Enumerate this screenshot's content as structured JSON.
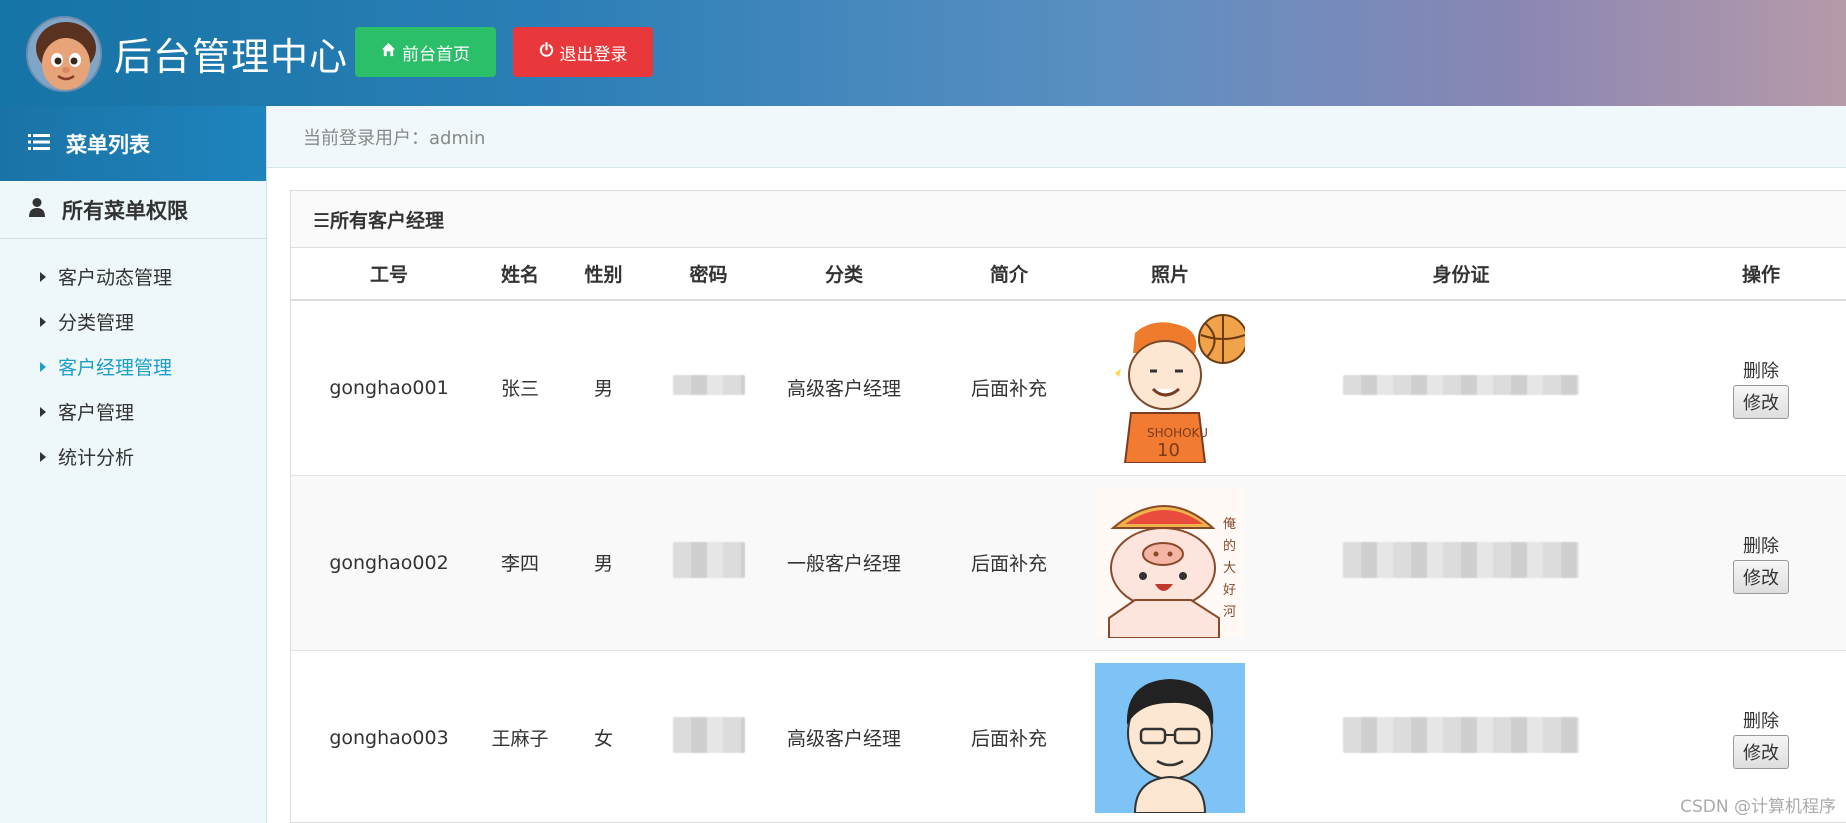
{
  "header": {
    "title": "后台管理中心",
    "home_button": "前台首页",
    "logout_button": "退出登录"
  },
  "sidebar": {
    "heading": "菜单列表",
    "section": "所有菜单权限",
    "items": [
      {
        "label": "客户动态管理"
      },
      {
        "label": "分类管理"
      },
      {
        "label": "客户经理管理"
      },
      {
        "label": "客户管理"
      },
      {
        "label": "统计分析"
      }
    ]
  },
  "userbar": {
    "text": "当前登录用户：admin"
  },
  "panel": {
    "title": "☰所有客户经理",
    "columns": [
      "工号",
      "姓名",
      "性别",
      "密码",
      "分类",
      "简介",
      "照片",
      "身份证",
      "操作"
    ],
    "rows": [
      {
        "id": "gonghao001",
        "name": "张三",
        "gender": "男",
        "category": "高级客户经理",
        "intro": "后面补充",
        "delete": "删除",
        "edit": "修改"
      },
      {
        "id": "gonghao002",
        "name": "李四",
        "gender": "男",
        "category": "一般客户经理",
        "intro": "后面补充",
        "delete": "删除",
        "edit": "修改"
      },
      {
        "id": "gonghao003",
        "name": "王麻子",
        "gender": "女",
        "category": "高级客户经理",
        "intro": "后面补充",
        "delete": "删除",
        "edit": "修改"
      }
    ]
  },
  "watermark": "CSDN @计算机程序",
  "colors": {
    "home_button": "#2cbf6a",
    "logout_button": "#e8383b",
    "active_menu": "#1c9fc7",
    "sidebar_head": "#1a73a6"
  }
}
